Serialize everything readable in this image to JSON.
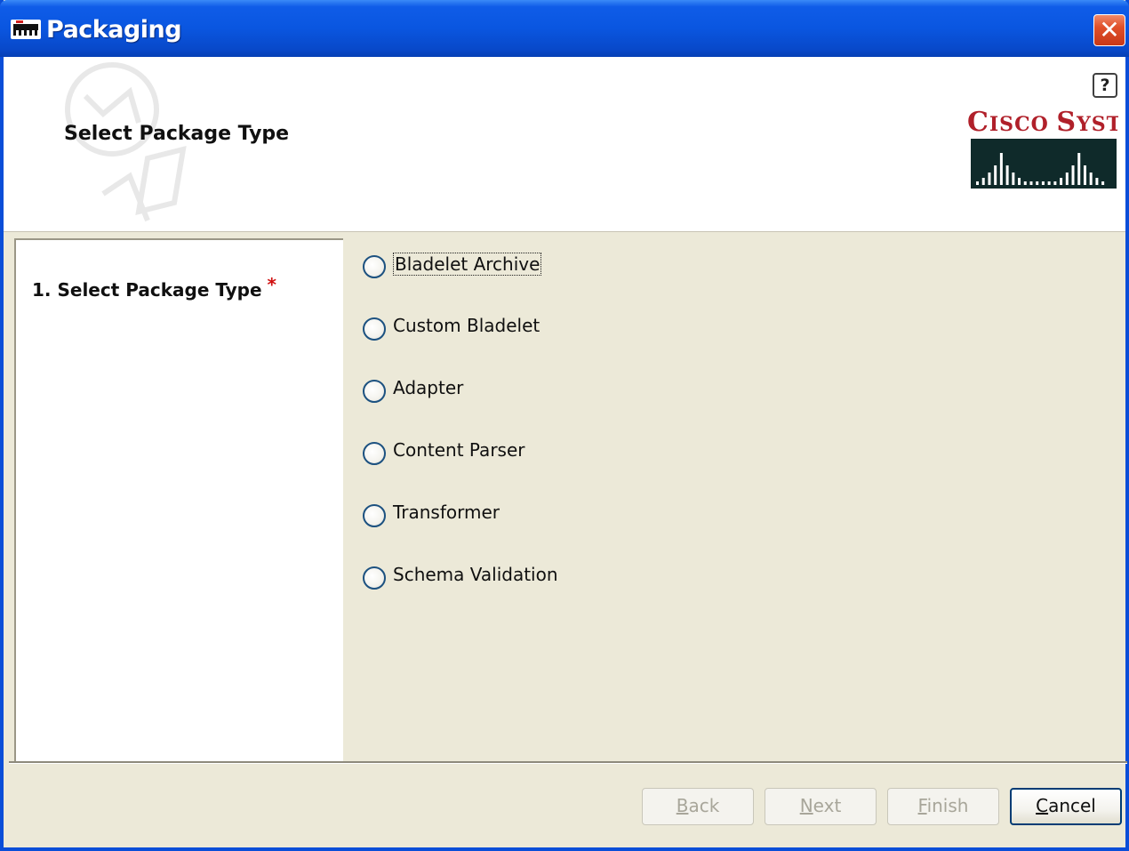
{
  "window": {
    "title": "Packaging",
    "close_glyph": "✕"
  },
  "header": {
    "title": "Select Package Type",
    "help_glyph": "?",
    "logo": {
      "text_first": "C",
      "text_rest": "ISCO ",
      "text_first2": "S",
      "text_rest2": "YSTEMS",
      "brand_color": "#b0202a"
    }
  },
  "steps": [
    {
      "label": "1. Select Package Type",
      "required_mark": "*"
    }
  ],
  "options": [
    {
      "label": "Bladelet Archive",
      "selected": false,
      "focused": true
    },
    {
      "label": "Custom Bladelet",
      "selected": false
    },
    {
      "label": "Adapter",
      "selected": false
    },
    {
      "label": "Content Parser",
      "selected": false
    },
    {
      "label": "Transformer",
      "selected": false
    },
    {
      "label": "Schema Validation",
      "selected": false
    }
  ],
  "buttons": {
    "back": {
      "mnemonic": "B",
      "rest": "ack",
      "enabled": false
    },
    "next": {
      "mnemonic": "N",
      "rest": "ext",
      "enabled": false
    },
    "finish": {
      "mnemonic": "F",
      "rest": "inish",
      "enabled": false
    },
    "cancel": {
      "mnemonic": "C",
      "rest": "ancel",
      "enabled": true
    }
  },
  "colors": {
    "titlebar": "#0a56e0",
    "dialog_bg": "#ece9d8",
    "required": "#d01010",
    "accent_border": "#003c74"
  }
}
